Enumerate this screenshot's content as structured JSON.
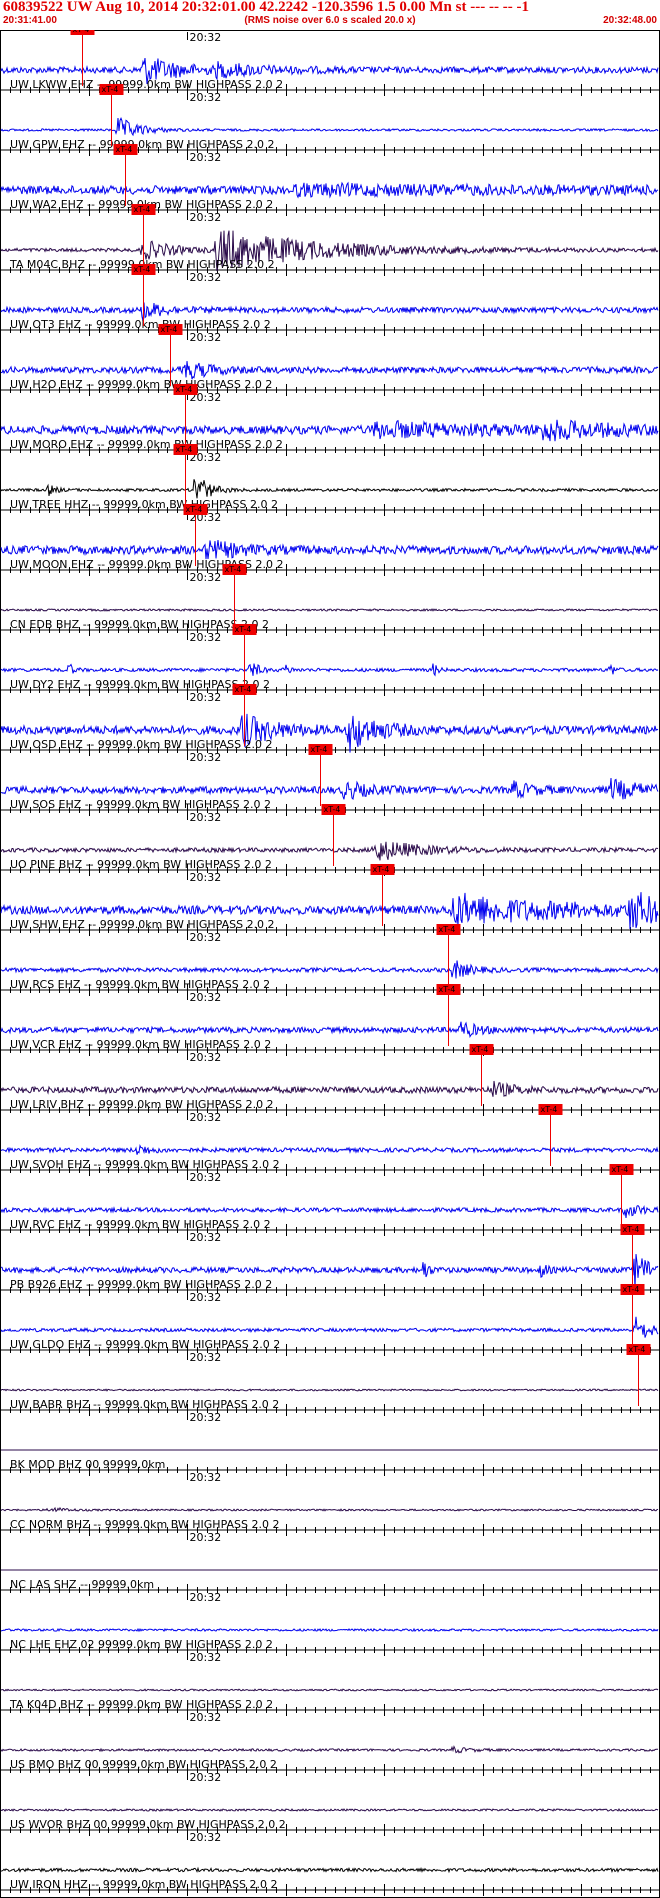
{
  "header": {
    "title": "60839522 UW Aug 10, 2014 20:32:01.00   42.2242 -120.3596  1.5 0.00 Mn st --- -- --   -1",
    "start_time": "20:31:41.00",
    "rms_note": "(RMS noise over 6.0 s scaled 20.0 x)",
    "end_time": "20:32:48.00"
  },
  "colors": {
    "blue_trace": "#0000ee",
    "dark_trace": "#2a0a4a",
    "black_trace": "#000000",
    "pick": "#ee0000",
    "title": "#e00000"
  },
  "chart_data": {
    "type": "line",
    "title": "60839522 UW Aug 10, 2014 20:32:01.00   42.2242 -120.3596  1.5 0.00 Mn st --- -- --   -1",
    "x_start": "20:31:41.00",
    "x_end": "20:32:48.00",
    "xlim_seconds": [
      0,
      67
    ],
    "minute_label": "20:32",
    "minute_mark_seconds": 19,
    "pick_label": "xT-4",
    "grid": false,
    "traces": [
      {
        "label": "UW LKWW EHZ -- 99999.0km BW  HIGHPASS  2.0  2",
        "pick_s": 8.3,
        "color": "blue",
        "noise": 0.22,
        "bursts": [
          {
            "s": 14.5,
            "amp": 0.95,
            "dur": 3.5
          },
          {
            "s": 22,
            "amp": 0.35,
            "dur": 5
          }
        ]
      },
      {
        "label": "UW GPW EHZ -- 99999.0km BW  HIGHPASS  2.0  2",
        "pick_s": 11.3,
        "color": "blue",
        "noise": 0.08,
        "bursts": [
          {
            "s": 12,
            "amp": 0.9,
            "dur": 2
          }
        ]
      },
      {
        "label": "UW WA2 EHZ -- 99999.0km BW  HIGHPASS  2.0  2",
        "pick_s": 12.7,
        "color": "blue",
        "noise": 0.3,
        "bursts": [
          {
            "s": 30,
            "amp": 0.25,
            "dur": 25
          }
        ]
      },
      {
        "label": "TA M04C BHZ -- 99999.0km BW  HIGHPASS  2.0  2",
        "pick_s": 14.5,
        "color": "dark",
        "noise": 0.12,
        "bursts": [
          {
            "s": 22,
            "amp": 1.5,
            "dur": 10
          },
          {
            "s": 14.5,
            "amp": 0.7,
            "dur": 3
          }
        ]
      },
      {
        "label": "UW OT3 EHZ -- 99999.0km BW  HIGHPASS  2.0  2",
        "pick_s": 14.5,
        "color": "blue",
        "noise": 0.2,
        "bursts": [
          {
            "s": 14.5,
            "amp": 0.6,
            "dur": 2
          }
        ]
      },
      {
        "label": "UW H2O EHZ -- 99999.0km BW  HIGHPASS  2.0  2",
        "pick_s": 17.3,
        "color": "blue",
        "noise": 0.22,
        "bursts": [
          {
            "s": 18.5,
            "amp": 0.65,
            "dur": 2.5
          }
        ]
      },
      {
        "label": "UW MORO EHZ -- 99999.0km BW  HIGHPASS  2.0  2",
        "pick_s": 18.8,
        "color": "blue",
        "noise": 0.3,
        "bursts": [
          {
            "s": 38,
            "amp": 0.45,
            "dur": 12
          },
          {
            "s": 55,
            "amp": 0.55,
            "dur": 6
          }
        ]
      },
      {
        "label": "UW TREE HHZ -- 99999.0km BW  HIGHPASS  2.0  2",
        "pick_s": 18.8,
        "color": "black",
        "noise": 0.1,
        "bursts": [
          {
            "s": 19.8,
            "amp": 1.4,
            "dur": 1.2
          },
          {
            "s": 5,
            "amp": 0.4,
            "dur": 0.6
          }
        ]
      },
      {
        "label": "UW MOON EHZ -- 99999.0km BW  HIGHPASS  2.0  2",
        "pick_s": 19.8,
        "color": "blue",
        "noise": 0.3,
        "bursts": [
          {
            "s": 21,
            "amp": 0.6,
            "dur": 3
          }
        ]
      },
      {
        "label": "CN EDB BHZ -- 99999.0km BW  HIGHPASS  2.0  2",
        "pick_s": 23.8,
        "color": "dark",
        "noise": 0.07,
        "bursts": []
      },
      {
        "label": "UW DY2 EHZ -- 99999.0km BW  HIGHPASS  2.0  2",
        "pick_s": 24.8,
        "color": "blue",
        "noise": 0.12,
        "bursts": [
          {
            "s": 25.5,
            "amp": 0.8,
            "dur": 0.6
          },
          {
            "s": 7,
            "amp": 0.5,
            "dur": 0.4
          },
          {
            "s": 29,
            "amp": 0.4,
            "dur": 0.4
          },
          {
            "s": 44,
            "amp": 0.45,
            "dur": 0.4
          },
          {
            "s": 62,
            "amp": 0.45,
            "dur": 0.4
          }
        ]
      },
      {
        "label": "UW OSD EHZ -- 99999.0km BW  HIGHPASS  2.0  2",
        "pick_s": 24.8,
        "color": "blue",
        "noise": 0.3,
        "bursts": [
          {
            "s": 24.5,
            "amp": 1.1,
            "dur": 3
          },
          {
            "s": 35.5,
            "amp": 1.4,
            "dur": 2.5
          }
        ]
      },
      {
        "label": "UW SOS EHZ -- 99999.0km BW  HIGHPASS  2.0  2",
        "pick_s": 32.5,
        "color": "blue",
        "noise": 0.25,
        "bursts": [
          {
            "s": 35,
            "amp": 0.6,
            "dur": 2
          },
          {
            "s": 52,
            "amp": 0.5,
            "dur": 2
          },
          {
            "s": 62,
            "amp": 0.65,
            "dur": 3
          }
        ]
      },
      {
        "label": "UO PINE BHZ -- 99999.0km BW  HIGHPASS  2.0  2",
        "pick_s": 33.8,
        "color": "dark",
        "noise": 0.15,
        "bursts": [
          {
            "s": 38,
            "amp": 0.8,
            "dur": 4
          }
        ]
      },
      {
        "label": "UW SHW EHZ -- 99999.0km BW  HIGHPASS  2.0  2",
        "pick_s": 38.8,
        "color": "blue",
        "noise": 0.3,
        "bursts": [
          {
            "s": 46,
            "amp": 1.05,
            "dur": 10
          },
          {
            "s": 64,
            "amp": 1.2,
            "dur": 3
          }
        ]
      },
      {
        "label": "UW RCS EHZ -- 99999.0km BW  HIGHPASS  2.0  2",
        "pick_s": 45.5,
        "color": "blue",
        "noise": 0.15,
        "bursts": [
          {
            "s": 46,
            "amp": 0.7,
            "dur": 1.5
          }
        ]
      },
      {
        "label": "UW VCR EHZ -- 99999.0km BW  HIGHPASS  2.0  2",
        "pick_s": 45.5,
        "color": "blue",
        "noise": 0.2,
        "bursts": [
          {
            "s": 46.8,
            "amp": 0.55,
            "dur": 1.5
          }
        ]
      },
      {
        "label": "UW LRIV BHZ -- 99999.0km BW  HIGHPASS  2.0  2",
        "pick_s": 48.8,
        "color": "dark",
        "noise": 0.22,
        "bursts": [
          {
            "s": 50,
            "amp": 0.5,
            "dur": 2
          }
        ]
      },
      {
        "label": "UW SVOH EHZ -- 99999.0km BW  HIGHPASS  2.0  2",
        "pick_s": 55.8,
        "color": "blue",
        "noise": 0.15,
        "bursts": [
          {
            "s": 14,
            "amp": 0.4,
            "dur": 1
          }
        ]
      },
      {
        "label": "UW RVC EHZ -- 99999.0km BW  HIGHPASS  2.0  2",
        "pick_s": 63.0,
        "color": "blue",
        "noise": 0.15,
        "bursts": [
          {
            "s": 63.5,
            "amp": 0.5,
            "dur": 1.5
          }
        ]
      },
      {
        "label": "PB B926 EHZ -- 99999.0km BW  HIGHPASS  2.0  2",
        "pick_s": 64.2,
        "color": "blue",
        "noise": 0.2,
        "bursts": [
          {
            "s": 43,
            "amp": 0.8,
            "dur": 0.4
          },
          {
            "s": 55,
            "amp": 0.55,
            "dur": 0.4
          },
          {
            "s": 64.5,
            "amp": 1.3,
            "dur": 1.5
          }
        ]
      },
      {
        "label": "UW GLDO EHZ -- 99999.0km BW  HIGHPASS  2.0  2",
        "pick_s": 64.2,
        "color": "blue",
        "noise": 0.12,
        "bursts": [
          {
            "s": 64.5,
            "amp": 0.9,
            "dur": 1.5
          }
        ]
      },
      {
        "label": "UW BABR BHZ -- 99999.0km BW  HIGHPASS  2.0  2",
        "pick_s": 64.8,
        "color": "dark",
        "noise": 0.06,
        "bursts": []
      },
      {
        "label": "BK MOD BHZ 00 99999.0km",
        "pick_s": null,
        "color": "dark",
        "noise": 0.0,
        "bursts": []
      },
      {
        "label": "CC NORM BHZ -- 99999.0km BW  HIGHPASS  2.0  2",
        "pick_s": null,
        "color": "dark",
        "noise": 0.06,
        "bursts": [
          {
            "s": 5,
            "amp": 0.2,
            "dur": 1.5
          }
        ]
      },
      {
        "label": "NC LAS SHZ -- 99999.0km",
        "pick_s": null,
        "color": "dark",
        "noise": 0.0,
        "bursts": []
      },
      {
        "label": "NC LHE EHZ 02 99999.0km BW  HIGHPASS  2.0  2",
        "pick_s": null,
        "color": "blue",
        "noise": 0.08,
        "bursts": []
      },
      {
        "label": "TA K04D BHZ -- 99999.0km BW  HIGHPASS  2.0  2",
        "pick_s": null,
        "color": "dark",
        "noise": 0.06,
        "bursts": []
      },
      {
        "label": "US BMO BHZ 00 99999.0km BW  HIGHPASS  2.0  2",
        "pick_s": null,
        "color": "dark",
        "noise": 0.08,
        "bursts": [
          {
            "s": 46,
            "amp": 0.2,
            "dur": 1.5
          }
        ]
      },
      {
        "label": "US WVOR BHZ 00 99999.0km BW  HIGHPASS  2.0  2",
        "pick_s": null,
        "color": "dark",
        "noise": 0.07,
        "bursts": []
      },
      {
        "label": "UW IRON HHZ -- 99999.0km BW  HIGHPASS  2.0  2",
        "pick_s": null,
        "color": "black",
        "noise": 0.12,
        "bursts": []
      }
    ]
  }
}
